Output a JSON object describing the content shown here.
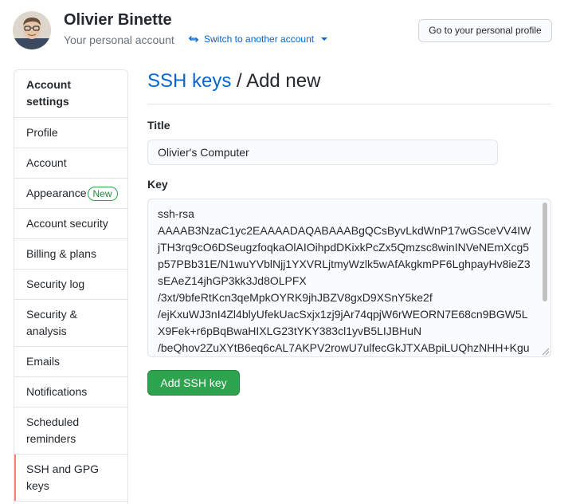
{
  "header": {
    "user_name": "Olivier Binette",
    "account_type": "Your personal account",
    "switch_label": "Switch to another account",
    "profile_button": "Go to your personal profile"
  },
  "sidebar": {
    "heading": "Account settings",
    "items": [
      {
        "label": "Profile"
      },
      {
        "label": "Account"
      },
      {
        "label": "Appearance",
        "badge": "New"
      },
      {
        "label": "Account security"
      },
      {
        "label": "Billing & plans"
      },
      {
        "label": "Security log"
      },
      {
        "label": "Security & analysis"
      },
      {
        "label": "Emails"
      },
      {
        "label": "Notifications"
      },
      {
        "label": "Scheduled reminders"
      },
      {
        "label": "SSH and GPG keys",
        "active": true
      }
    ]
  },
  "main": {
    "breadcrumb_link": "SSH keys",
    "separator": "/",
    "page_title": "Add new",
    "title_label": "Title",
    "title_value": "Olivier's Computer",
    "key_label": "Key",
    "key_value": "ssh-rsa\nAAAAB3NzaC1yc2EAAAADAQABAAABgQCsByvLkdWnP17wGSceVV4IW\njTH3rq9cO6DSeugzfoqkaOlAIOihpdDKixkPcZx5Qmzsc8winINVeNEmXcg5\np57PBb31E/N1wuYVblNjj1YXVRLjtmyWzlk5wAfAkgkmPF6LghpayHv8ieZ3\nsEAeZ14jhGP3kk3Jd8OLPFX\n/3xt/9bfeRtKcn3qeMpkOYRK9jhJBZV8gxD9XSnY5ke2f\n/ejKxuWJ3nI4Zl4blyUfekUacSxjx1zj9jAr74qpjW6rWEORN7E68cn9BGW5L\nX9Fek+r6pBqBwaHIXLG23tYKY383cl1yvB5LIJBHuN\n/beQhov2ZuXYtB6eq6cAL7AKPV2rowU7ulfecGkJTXABpiLUQhzNHH+Kgu",
    "submit_button": "Add SSH key"
  },
  "colors": {
    "link": "#0366d6",
    "primary_button": "#2ea44f",
    "active_indicator": "#f9826c",
    "badge": "#28a745"
  }
}
